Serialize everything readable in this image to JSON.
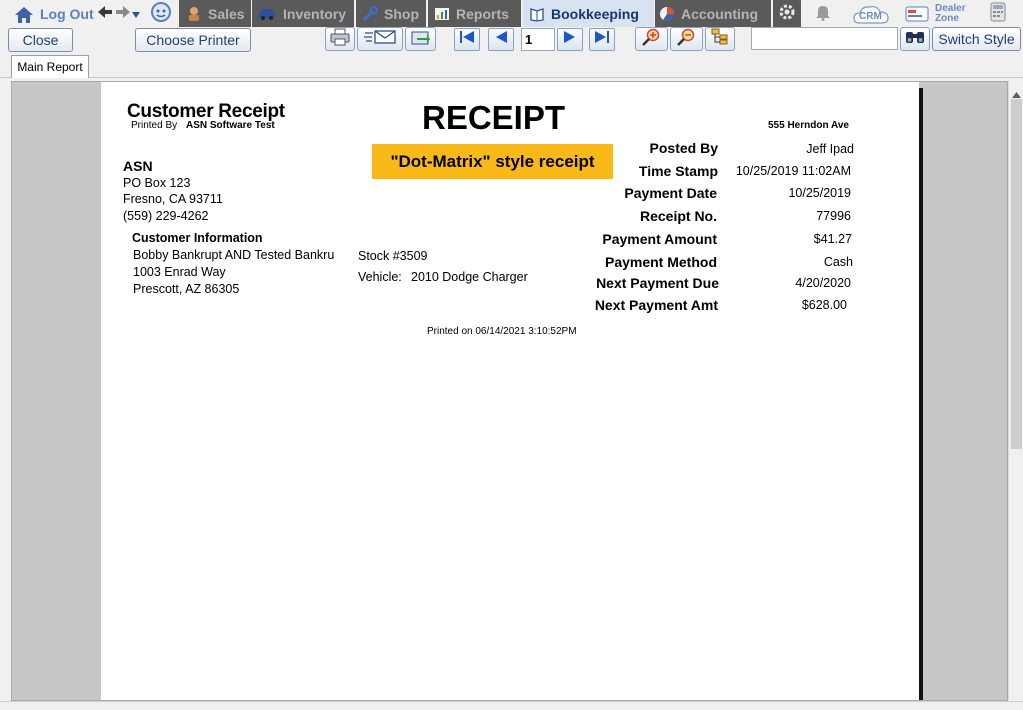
{
  "nav": {
    "logout": "Log Out",
    "sales": "Sales",
    "inventory": "Inventory",
    "shop": "Shop",
    "reports": "Reports",
    "bookkeeping": "Bookkeeping",
    "accounting": "Accounting",
    "crm": "CRM",
    "dealer_zone_line1": "Dealer",
    "dealer_zone_line2": "Zone",
    "icons": [
      "home-icon",
      "back-arrow-icon",
      "forward-arrow-icon",
      "dropdown-icon",
      "user-face-icon",
      "sales-icon",
      "inventory-car-icon",
      "shop-wrench-icon",
      "reports-icon",
      "book-icon",
      "pie-chart-icon",
      "gear-icon",
      "bell-icon",
      "crm-cloud-icon",
      "dealer-zone-icon",
      "calculator-icon"
    ]
  },
  "toolbar": {
    "close": "Close",
    "choose_printer": "Choose Printer",
    "page_number": "1",
    "search_value": "",
    "switch_style": "Switch Style"
  },
  "tabs": {
    "main": "Main Report"
  },
  "report": {
    "title": "Customer Receipt",
    "printed_by_label": "Printed By",
    "printed_by_value": "ASN Software Test",
    "heading": "RECEIPT",
    "address_right": "555 Herndon Ave",
    "badge": "\"Dot-Matrix\" style receipt",
    "company": {
      "name": "ASN",
      "line1": "PO Box 123",
      "line2": "Fresno,  CA 93711",
      "phone": "(559) 229-4262"
    },
    "customer": {
      "heading": "Customer Information",
      "name": "Bobby Bankrupt AND Tested Bankru",
      "address1": "1003 Enrad Way",
      "address2": "Prescott,  AZ 86305"
    },
    "stock": "Stock #3509",
    "vehicle_label": "Vehicle:",
    "vehicle_value": "2010 Dodge Charger",
    "details": [
      {
        "label": "Posted By",
        "value": "Jeff Ipad"
      },
      {
        "label": "Time Stamp",
        "value": "10/25/2019  11:02AM"
      },
      {
        "label": "Payment Date",
        "value": "10/25/2019"
      },
      {
        "label": "Receipt No.",
        "value": "77996"
      },
      {
        "label": "Payment Amount",
        "value": "$41.27"
      },
      {
        "label": "Payment Method",
        "value": "Cash"
      },
      {
        "label": "Next Payment Due",
        "value": "4/20/2020"
      },
      {
        "label": "Next Payment  Amt",
        "value": "$628.00"
      }
    ],
    "printed_on": "Printed on 06/14/2021  3:10:52PM"
  },
  "colors": {
    "badge_bg": "#f9b918",
    "nav_dark": "#5a5a5a",
    "nav_active": "#d8e3f1",
    "accent_blue": "#1f3f7a"
  }
}
